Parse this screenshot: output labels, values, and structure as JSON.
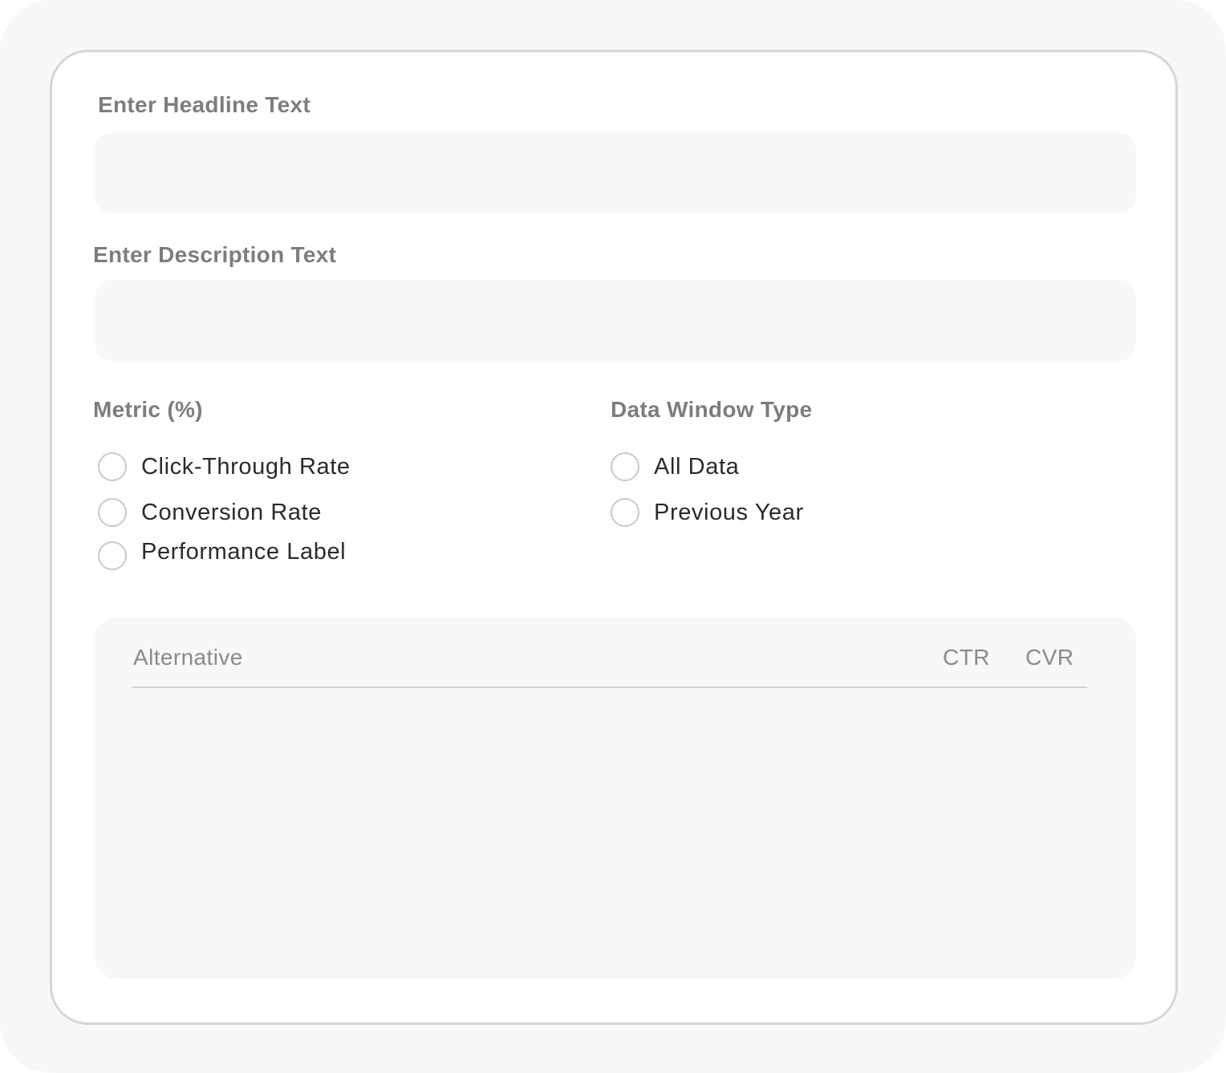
{
  "form": {
    "headline": {
      "label": "Enter Headline Text",
      "value": "",
      "placeholder": ""
    },
    "description": {
      "label": "Enter Description Text",
      "value": "",
      "placeholder": ""
    },
    "metric": {
      "label": "Metric (%)",
      "options": [
        {
          "label": "Click-Through Rate",
          "selected": false
        },
        {
          "label": "Conversion Rate",
          "selected": false
        },
        {
          "label": "Performance Label",
          "selected": false
        }
      ]
    },
    "data_window": {
      "label": "Data Window Type",
      "options": [
        {
          "label": "All Data",
          "selected": false
        },
        {
          "label": "Previous Year",
          "selected": false
        }
      ]
    }
  },
  "table": {
    "columns": [
      "Alternative",
      "CTR",
      "CVR"
    ],
    "rows": []
  },
  "colors": {
    "background": "#f8f8f8",
    "card": "#ffffff",
    "border": "#d6d6d6",
    "label": "#7d7d7d",
    "text": "#2b2b2b"
  }
}
